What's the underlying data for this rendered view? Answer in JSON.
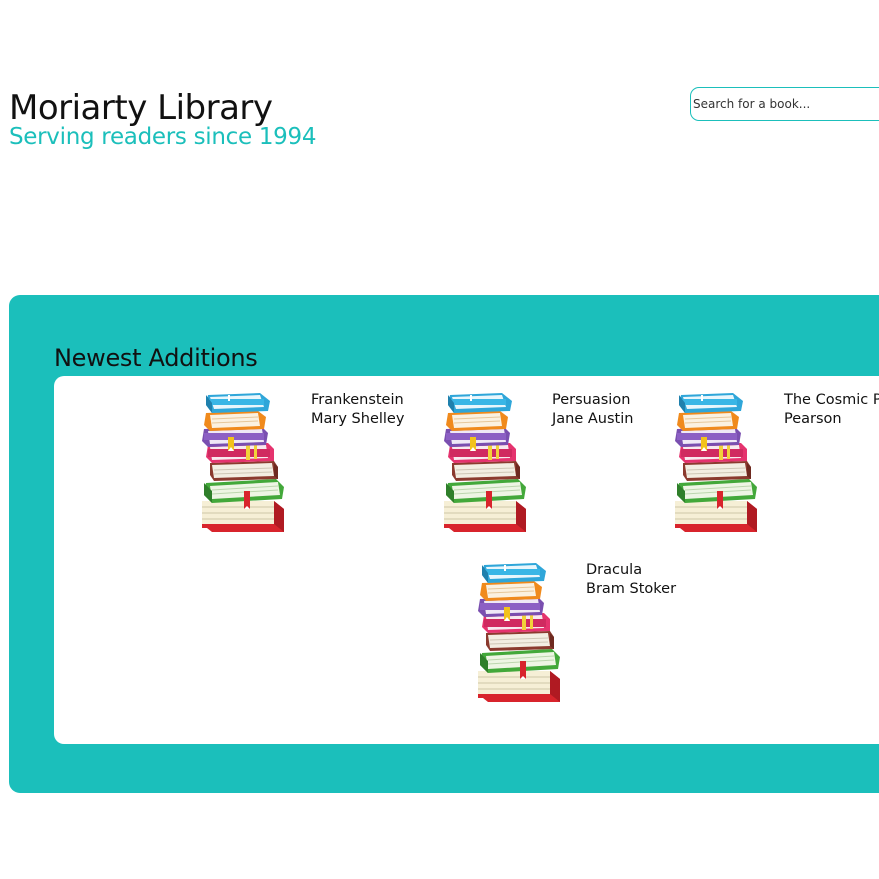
{
  "header": {
    "title": "Moriarty Library",
    "tagline": "Serving readers since 1994"
  },
  "search": {
    "placeholder": "Search for a book..."
  },
  "newest": {
    "heading": "Newest Additions",
    "books": [
      {
        "title": "Frankenstein",
        "author": "Mary Shelley",
        "icon": "book-stack-icon"
      },
      {
        "title": "Persuasion",
        "author": "Jane Austin",
        "icon": "book-stack-icon"
      },
      {
        "title": "The Cosmic Perspective",
        "author": "Pearson",
        "icon": "book-stack-icon"
      },
      {
        "title": "Dracula",
        "author": "Bram Stoker",
        "icon": "book-stack-icon"
      }
    ]
  },
  "colors": {
    "accent": "#1bbfbb",
    "text": "#111111",
    "background": "#ffffff"
  }
}
